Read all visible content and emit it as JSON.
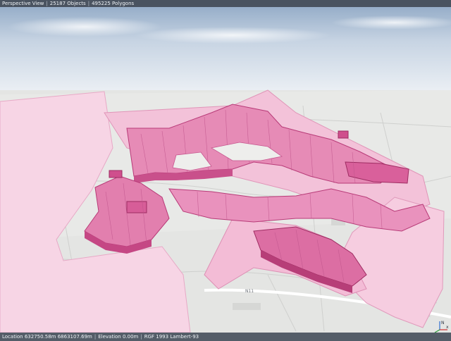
{
  "status_top": {
    "view": "Perspective View",
    "objects": "25187 Objects",
    "polygons": "495225 Polygons"
  },
  "status_bottom": {
    "location": "Location 632750.58m 6863107.69m",
    "elevation": "Elevation 0.00m",
    "crs": "RGF 1993 Lambert-93"
  },
  "map_labels": {
    "road": "N11"
  },
  "compass": {
    "north": "N",
    "x": "x"
  },
  "colors": {
    "sky_top": "#9eb3cc",
    "sky_bottom": "#f4f6f8",
    "ground": "#e3e4e2",
    "zone_light": "#f6cfe1",
    "zone_mid": "#e88ab7",
    "zone_dark": "#d94a8c",
    "zone_edge": "#a8316a"
  }
}
